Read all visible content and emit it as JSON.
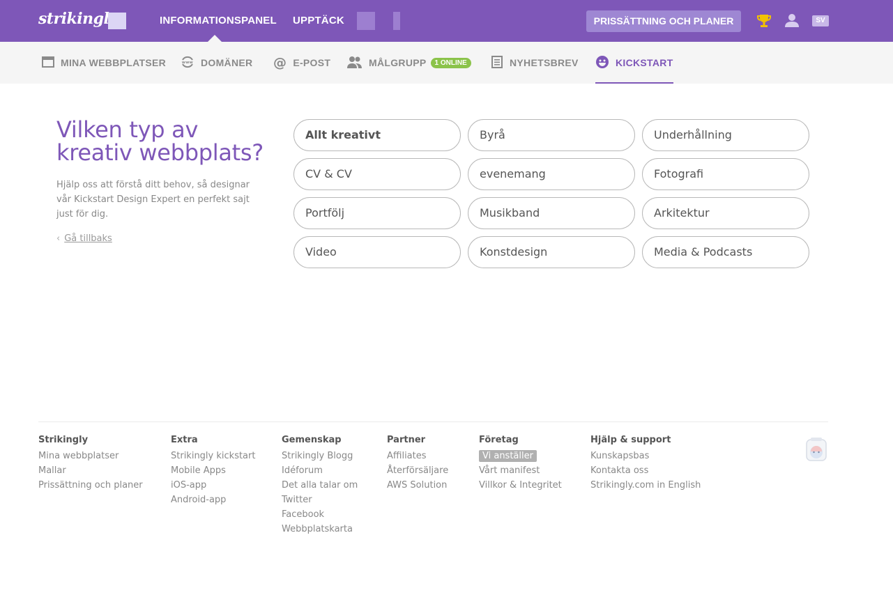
{
  "topbar": {
    "logo": "strikingly",
    "nav": [
      "INFORMATIONSPANEL",
      "UPPTÄCK"
    ],
    "pricing_button": "PRISSÄTTNING OCH PLANER",
    "lang": "SV",
    "icons": [
      "trophy-icon",
      "user-icon"
    ],
    "accent_color": "#7e57b8"
  },
  "subnav": {
    "items": [
      {
        "label": "MINA WEBBPLATSER",
        "icon": "browser-window-icon"
      },
      {
        "label": "DOMÄNER",
        "icon": "www-icon"
      },
      {
        "label": "E-POST",
        "icon": "at-icon"
      },
      {
        "label": "MÅLGRUPP",
        "icon": "people-icon",
        "badge": "1 ONLINE"
      },
      {
        "label": "NYHETSBREV",
        "icon": "newsletter-icon"
      },
      {
        "label": "KICKSTART",
        "icon": "smiley-icon",
        "active": true
      }
    ],
    "badge_color": "#8bc34a"
  },
  "main": {
    "heading": "Vilken typ av kreativ webbplats?",
    "description": "Hjälp oss att förstå ditt behov, så designar vår Kickstart Design Expert en perfekt sajt just för dig.",
    "back_link": "Gå tillbaks",
    "choices": [
      "Allt kreativt",
      "Byrå",
      "Underhållning",
      "CV & CV",
      "evenemang",
      "Fotografi",
      "Portfölj",
      "Musikband",
      "Arkitektur",
      "Video",
      "Konstdesign",
      "Media & Podcasts"
    ]
  },
  "footer": {
    "columns": [
      {
        "title": "Strikingly",
        "links": [
          "Mina webbplatser",
          "Mallar",
          "Prissättning och planer"
        ]
      },
      {
        "title": "Extra",
        "links": [
          "Strikingly kickstart",
          "Mobile Apps",
          "iOS-app",
          "Android-app"
        ]
      },
      {
        "title": "Gemenskap",
        "links": [
          "Strikingly Blogg",
          "Idéforum",
          "Det alla talar om",
          "Twitter",
          "Facebook",
          "Webbplatskarta"
        ]
      },
      {
        "title": "Partner",
        "links": [
          "Affiliates",
          "Återförsäljare",
          "AWS Solution"
        ]
      },
      {
        "title": "Företag",
        "links": [
          "Vi anställer",
          "Vårt manifest",
          "Villkor & Integritet"
        ]
      },
      {
        "title": "Hjälp & support",
        "links": [
          "Kunskapsbas",
          "Kontakta oss",
          "Strikingly.com in English"
        ]
      }
    ]
  }
}
